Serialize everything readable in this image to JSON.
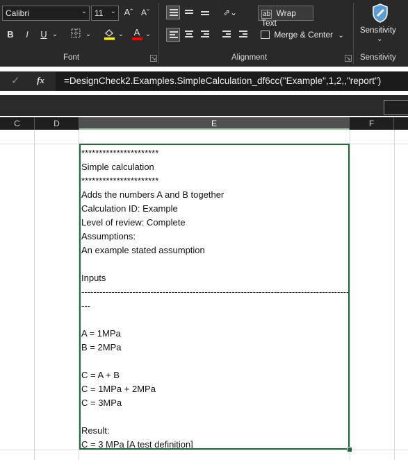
{
  "ribbon": {
    "font_name": "Calibri",
    "font_size": "11",
    "grow_font": "Aˆ",
    "shrink_font": "Aˇ",
    "bold": "B",
    "italic": "I",
    "underline": "U",
    "font_color_letter": "A",
    "wrap_text": "Wrap Text",
    "wrap_icon_text": "ab",
    "merge_center": "Merge & Center",
    "sensitivity": "Sensitivity",
    "groups": {
      "font": "Font",
      "alignment": "Alignment",
      "sensitivity": "Sensitivity"
    },
    "colors": {
      "highlight": "#ffff00",
      "font_color": "#ff0000"
    }
  },
  "formula_bar": {
    "fx_label": "fx",
    "formula": "=DesignCheck2.Examples.SimpleCalculation_df6cc(\"Example\",1,2,,\"report\")"
  },
  "columns": {
    "c": "C",
    "d": "D",
    "e": "E",
    "f": "F"
  },
  "cell_lines": [
    "**********************",
    "Simple calculation",
    "**********************",
    "Adds the numbers A and B together",
    "Calculation ID: Example",
    "Level of review: Complete",
    "Assumptions:",
    "An example stated assumption",
    "",
    "Inputs",
    "------------------------------------------------------------------------------------------------------------------------------",
    "---",
    "",
    "A = 1MPa",
    "B = 2MPa",
    "",
    "C = A + B",
    "C = 1MPa + 2MPa",
    "C = 3MPa",
    "",
    "Result:",
    "C = 3 MPa [A test definition]"
  ],
  "accent_color": "#1e6b3a"
}
